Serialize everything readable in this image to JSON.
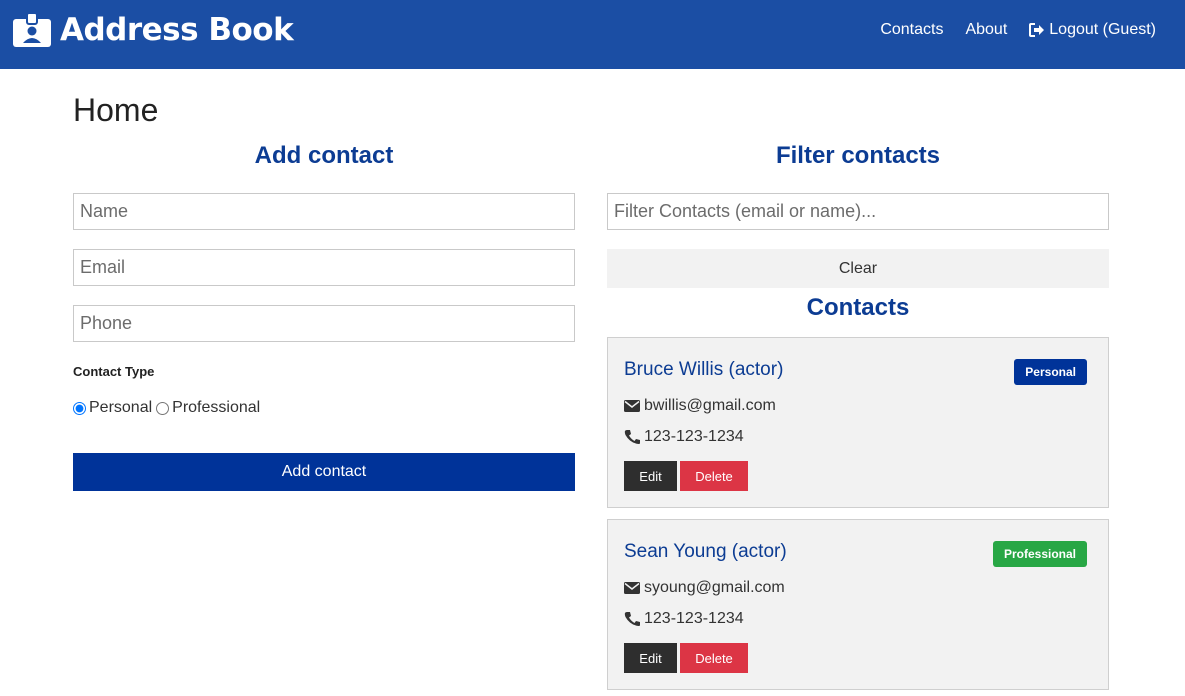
{
  "navbar": {
    "brand_title": "Address Book",
    "brand_icon": "id-badge-icon",
    "links": {
      "contacts": "Contacts",
      "about": "About",
      "logout": "Logout (Guest)"
    }
  },
  "page": {
    "title": "Home"
  },
  "add_form": {
    "heading": "Add contact",
    "name_placeholder": "Name",
    "email_placeholder": "Email",
    "phone_placeholder": "Phone",
    "name_value": "",
    "email_value": "",
    "phone_value": "",
    "type_label": "Contact Type",
    "type_options": [
      "Personal",
      "Professional"
    ],
    "selected_type": "Personal",
    "submit_label": "Add contact"
  },
  "filter": {
    "heading": "Filter contacts",
    "placeholder": "Filter Contacts (email or name)...",
    "value": "",
    "clear_label": "Clear"
  },
  "contacts": {
    "heading": "Contacts",
    "items": [
      {
        "name": "Bruce Willis (actor)",
        "email": "bwillis@gmail.com",
        "phone": "123-123-1234",
        "type": "Personal",
        "badge_color": "#003399",
        "edit_label": "Edit",
        "delete_label": "Delete"
      },
      {
        "name": "Sean Young (actor)",
        "email": "syoung@gmail.com",
        "phone": "123-123-1234",
        "type": "Professional",
        "badge_color": "#28a745",
        "edit_label": "Edit",
        "delete_label": "Delete"
      }
    ]
  },
  "colors": {
    "navbar": "#1b4ea4",
    "primary": "#003399",
    "danger": "#dc3545",
    "dark": "#2e2e2e",
    "success": "#28a745"
  }
}
